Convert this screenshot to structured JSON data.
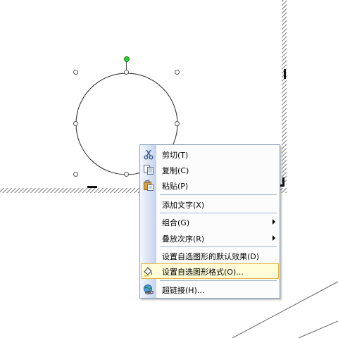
{
  "canvas": {
    "shape": "circle"
  },
  "context_menu": {
    "items": [
      {
        "label": "剪切(T)",
        "icon": "scissors-icon"
      },
      {
        "label": "复制(C)",
        "icon": "copy-icon"
      },
      {
        "label": "粘贴(P)",
        "icon": "paste-icon"
      },
      {
        "label": "添加文字(X)"
      },
      {
        "label": "组合(G)",
        "submenu": true
      },
      {
        "label": "叠放次序(R)",
        "submenu": true
      },
      {
        "label": "设置自选图形的默认效果(D)"
      },
      {
        "label": "设置自选图形格式(O)...",
        "icon": "format-shape-icon",
        "highlighted": true
      },
      {
        "label": "超链接(H)...",
        "icon": "hyperlink-icon"
      }
    ]
  },
  "colors": {
    "menu_border": "#7f9db9",
    "highlight_bg": "#fffcd8",
    "highlight_border": "#e1b940",
    "rotate_handle": "#33cc33"
  }
}
